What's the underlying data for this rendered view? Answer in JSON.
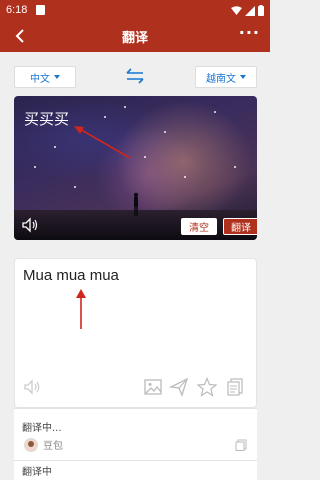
{
  "status": {
    "time": "6:18"
  },
  "appbar": {
    "title": "翻译",
    "more": "···"
  },
  "languages": {
    "source": "中文",
    "target": "越南文"
  },
  "image_card": {
    "overlay_text": "买买买",
    "clear_label": "清空",
    "translate_label": "翻译"
  },
  "input": {
    "text": "Mua mua mua"
  },
  "results": [
    {
      "text": "翻译中...",
      "engine": "豆包"
    },
    {
      "text": "翻译中"
    }
  ],
  "colors": {
    "primary": "#b0301e",
    "link": "#1976d2",
    "annotation_arrow": "#d0261c"
  }
}
